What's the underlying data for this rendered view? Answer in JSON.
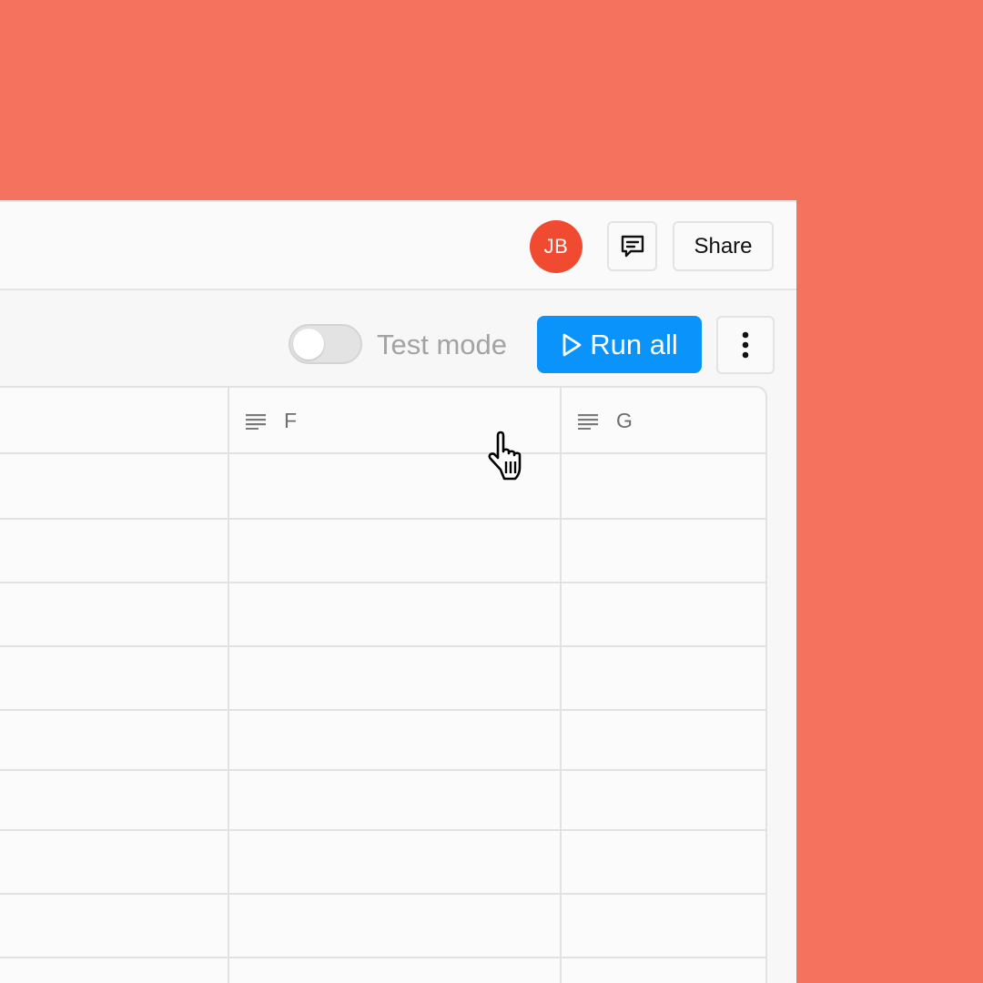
{
  "header": {
    "avatar_initials": "JB",
    "avatar_color": "#F04A30",
    "comment_icon": "comment-icon",
    "share_label": "Share"
  },
  "toolbar": {
    "test_mode_label": "Test mode",
    "test_mode_on": false,
    "run_all_label": "Run all",
    "run_all_color": "#0A93FB",
    "more_icon": "more-vertical-icon"
  },
  "grid": {
    "columns": [
      {
        "label": "F",
        "icon": "text-align-icon"
      },
      {
        "label": "G",
        "icon": "text-align-icon"
      }
    ]
  },
  "colors": {
    "background": "#F5735E",
    "accent": "#0A93FB"
  }
}
